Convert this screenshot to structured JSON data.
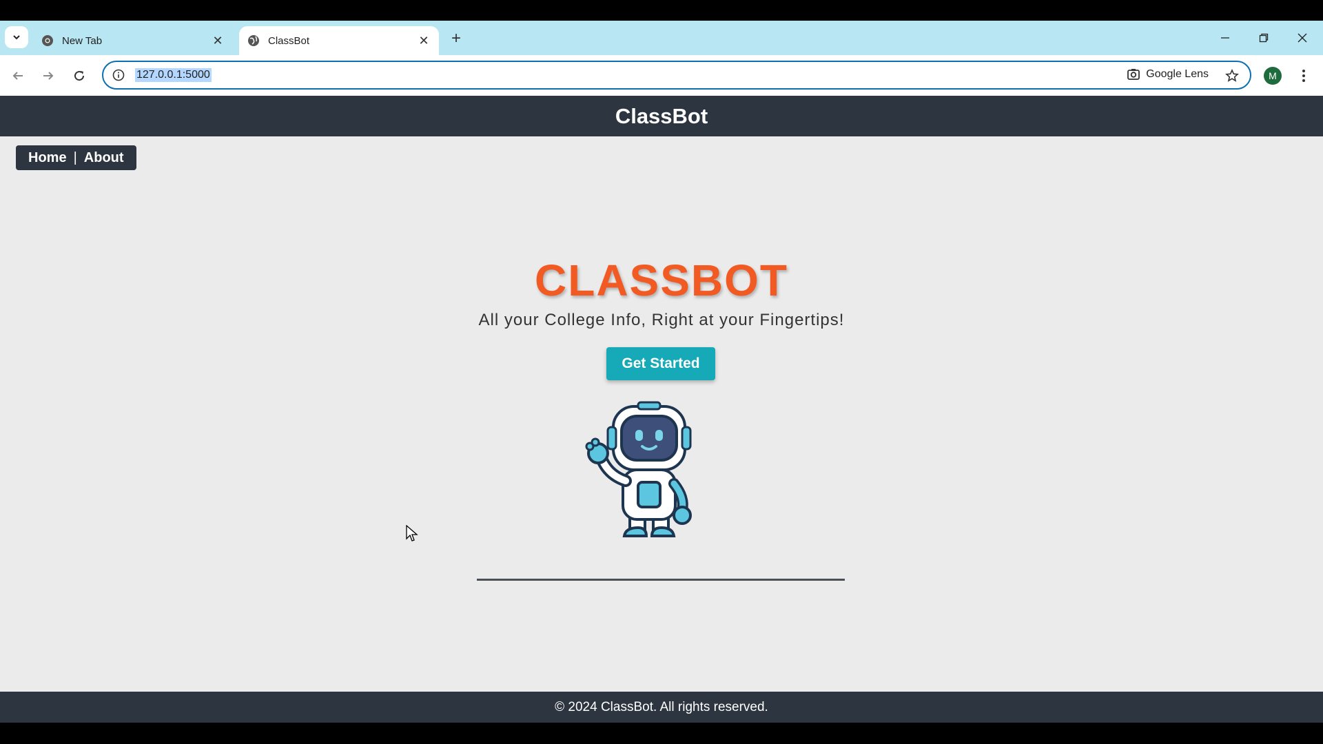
{
  "browser": {
    "tabs": [
      {
        "title": "New Tab",
        "active": false
      },
      {
        "title": "ClassBot",
        "active": true
      }
    ],
    "url": "127.0.0.1:5000",
    "lens_label": "Google Lens",
    "profile_initial": "M"
  },
  "site": {
    "brand": "ClassBot",
    "nav": {
      "home": "Home",
      "separator": "|",
      "about": "About"
    },
    "hero": {
      "title": "CLASSBOT",
      "subtitle": "All your College Info, Right at your Fingertips!",
      "cta": "Get Started"
    },
    "footer": "© 2024 ClassBot. All rights reserved."
  },
  "colors": {
    "header_bg": "#2d3540",
    "title_accent": "#f25a23",
    "cta_bg": "#16a9b7",
    "page_bg": "#ebebeb",
    "tabstrip_bg": "#b8e6f3"
  }
}
